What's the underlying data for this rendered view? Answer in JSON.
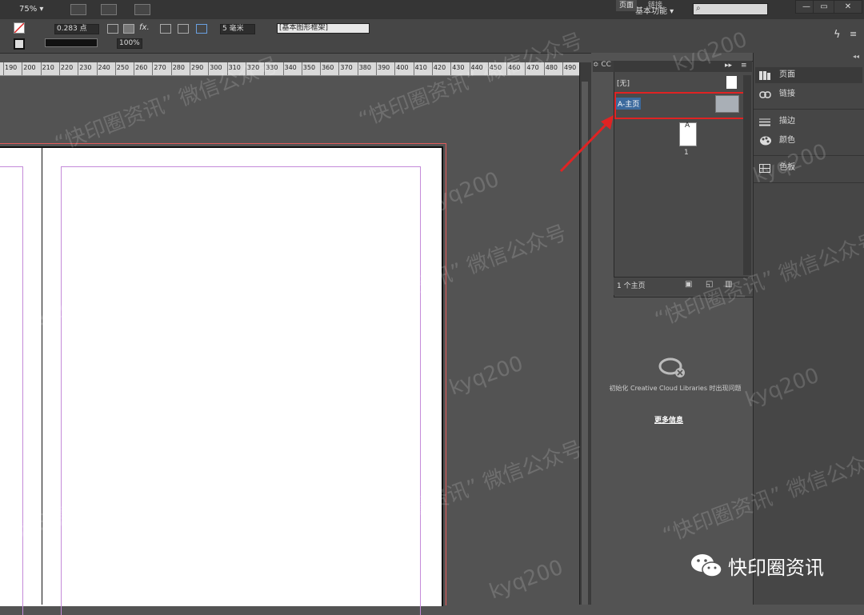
{
  "app_bar": {
    "zoom": "75% ▾",
    "workspace": "基本功能 ▾",
    "window_buttons": [
      "—",
      "▭",
      "✕"
    ]
  },
  "control_bar": {
    "stroke_weight": "0.283 点",
    "gap": "5 毫米",
    "opacity": "100%",
    "style": "[基本图形框架]"
  },
  "ruler_ticks": [
    "190",
    "200",
    "210",
    "220",
    "230",
    "240",
    "250",
    "260",
    "270",
    "280",
    "290",
    "300",
    "310",
    "320",
    "330",
    "340",
    "350",
    "360",
    "370",
    "380",
    "390",
    "400",
    "410",
    "420",
    "430",
    "440",
    "450",
    "460",
    "470",
    "480",
    "490"
  ],
  "pages_panel": {
    "cc_tab": "≎ CC",
    "tabs": [
      "页面",
      "链接"
    ],
    "none_label": "[无]",
    "master_label": "A-主页",
    "page_number": "1",
    "footer_count": "1 个主页"
  },
  "libraries": {
    "message": "初始化 Creative Cloud Libraries 时出现问题",
    "more_info": "更多信息"
  },
  "dock": {
    "items": [
      {
        "label": "页面",
        "icon": "pages-icon"
      },
      {
        "label": "链接",
        "icon": "links-icon"
      },
      {
        "label": "描边",
        "icon": "stroke-icon"
      },
      {
        "label": "颜色",
        "icon": "color-icon"
      },
      {
        "label": "色板",
        "icon": "swatches-icon"
      }
    ]
  },
  "watermark": {
    "brand": "快印圈资讯",
    "texts": [
      "kyq200",
      "“快印圈资讯” 微信公众号"
    ]
  },
  "colors": {
    "highlight": "#e02323",
    "selection": "#3c6a9d",
    "margin": "#c48ad9"
  }
}
